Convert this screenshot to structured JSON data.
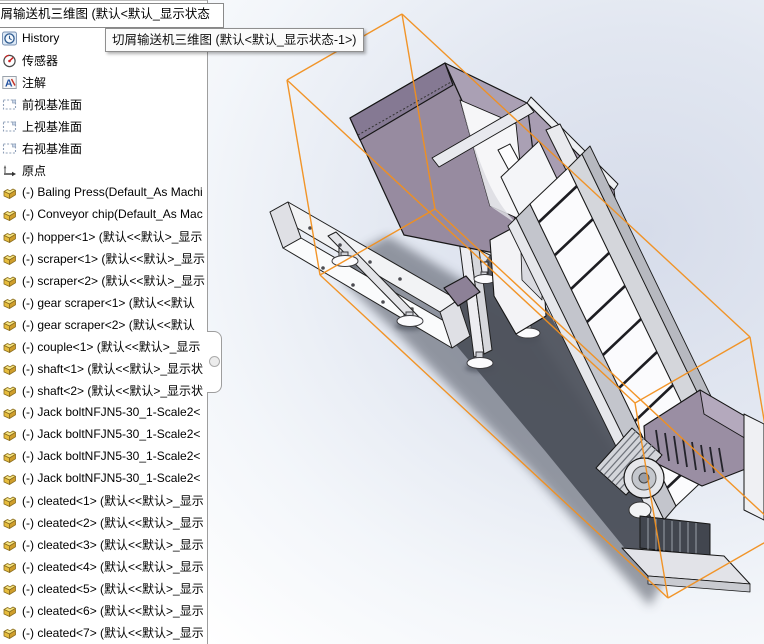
{
  "window": {
    "app": "SolidWorks assembly view"
  },
  "feature_tree": {
    "root_overlay_label": "切屑输送机三维图  (默认<默认_显示状态",
    "tooltip_text": "切屑输送机三维图  (默认<默认_显示状态-1>)",
    "items": [
      {
        "icon": "history-icon",
        "label": "History"
      },
      {
        "icon": "sensor-icon",
        "label": "传感器"
      },
      {
        "icon": "annotation-icon",
        "label": "注解"
      },
      {
        "icon": "plane-icon",
        "label": "前视基准面"
      },
      {
        "icon": "plane-icon",
        "label": "上视基准面"
      },
      {
        "icon": "plane-icon",
        "label": "右视基准面"
      },
      {
        "icon": "origin-icon",
        "label": "原点"
      },
      {
        "icon": "part-icon",
        "label": "(-) Baling Press(Default_As Machi"
      },
      {
        "icon": "part-icon",
        "label": "(-) Conveyor chip(Default_As Mac"
      },
      {
        "icon": "part-icon",
        "label": "(-) hopper<1> (默认<<默认>_显示"
      },
      {
        "icon": "part-icon",
        "label": "(-) scraper<1> (默认<<默认>_显示"
      },
      {
        "icon": "part-icon",
        "label": "(-) scraper<2> (默认<<默认>_显示"
      },
      {
        "icon": "part-icon",
        "label": "(-) gear scraper<1> (默认<<默认"
      },
      {
        "icon": "part-icon",
        "label": "(-) gear scraper<2> (默认<<默认"
      },
      {
        "icon": "part-icon",
        "label": "(-) couple<1> (默认<<默认>_显示"
      },
      {
        "icon": "part-icon",
        "label": "(-) shaft<1> (默认<<默认>_显示状"
      },
      {
        "icon": "part-icon",
        "label": "(-) shaft<2> (默认<<默认>_显示状"
      },
      {
        "icon": "part-icon",
        "label": "(-) Jack boltNFJN5-30_1-Scale2<"
      },
      {
        "icon": "part-icon",
        "label": "(-) Jack boltNFJN5-30_1-Scale2<"
      },
      {
        "icon": "part-icon",
        "label": "(-) Jack boltNFJN5-30_1-Scale2<"
      },
      {
        "icon": "part-icon",
        "label": "(-) Jack boltNFJN5-30_1-Scale2<"
      },
      {
        "icon": "part-icon",
        "label": "(-) cleated<1> (默认<<默认>_显示"
      },
      {
        "icon": "part-icon",
        "label": "(-) cleated<2> (默认<<默认>_显示"
      },
      {
        "icon": "part-icon",
        "label": "(-) cleated<3> (默认<<默认>_显示"
      },
      {
        "icon": "part-icon",
        "label": "(-) cleated<4> (默认<<默认>_显示"
      },
      {
        "icon": "part-icon",
        "label": "(-) cleated<5> (默认<<默认>_显示"
      },
      {
        "icon": "part-icon",
        "label": "(-) cleated<6> (默认<<默认>_显示"
      },
      {
        "icon": "part-icon",
        "label": "(-) cleated<7> (默认<<默认>_显示"
      }
    ]
  },
  "viewport": {
    "model_name": "切屑输送机 (chip conveyor) 3D assembly",
    "colors": {
      "selection_box": "#F2901E",
      "part_purple": "#9A8EA3",
      "part_white": "#F4F5F8",
      "part_gray": "#C3C5CC",
      "background_tint": "#D6DCEA"
    }
  }
}
